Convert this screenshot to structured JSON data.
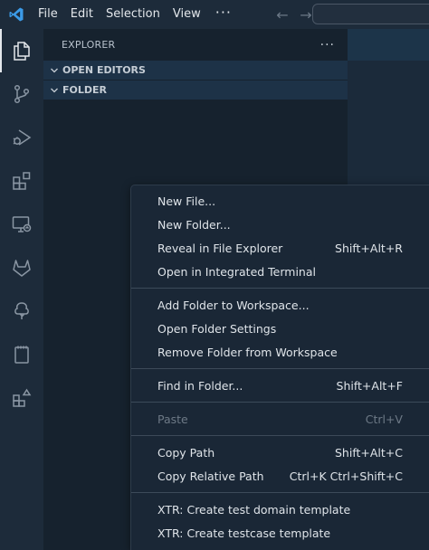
{
  "titlebar": {
    "menus": [
      "File",
      "Edit",
      "Selection",
      "View"
    ],
    "more": "···",
    "back_arrow": "←",
    "forward_arrow": "→"
  },
  "activitybar": {
    "icons": [
      "files-icon",
      "source-control-icon",
      "run-debug-icon",
      "extensions-icon",
      "remote-explorer-icon",
      "gitlab-icon",
      "tree-icon",
      "notebook-icon",
      "add-extension-icon"
    ]
  },
  "sidebar": {
    "title": "EXPLORER",
    "more": "···",
    "sections": [
      {
        "label": "OPEN EDITORS"
      },
      {
        "label": "FOLDER"
      }
    ]
  },
  "context_menu": {
    "groups": [
      [
        {
          "label": "New File...",
          "shortcut": ""
        },
        {
          "label": "New Folder...",
          "shortcut": ""
        },
        {
          "label": "Reveal in File Explorer",
          "shortcut": "Shift+Alt+R"
        },
        {
          "label": "Open in Integrated Terminal",
          "shortcut": ""
        }
      ],
      [
        {
          "label": "Add Folder to Workspace...",
          "shortcut": ""
        },
        {
          "label": "Open Folder Settings",
          "shortcut": ""
        },
        {
          "label": "Remove Folder from Workspace",
          "shortcut": ""
        }
      ],
      [
        {
          "label": "Find in Folder...",
          "shortcut": "Shift+Alt+F"
        }
      ],
      [
        {
          "label": "Paste",
          "shortcut": "Ctrl+V",
          "disabled": true
        }
      ],
      [
        {
          "label": "Copy Path",
          "shortcut": "Shift+Alt+C"
        },
        {
          "label": "Copy Relative Path",
          "shortcut": "Ctrl+K Ctrl+Shift+C"
        }
      ],
      [
        {
          "label": "XTR: Create test domain template",
          "shortcut": ""
        },
        {
          "label": "XTR: Create testcase template",
          "shortcut": ""
        }
      ]
    ]
  },
  "colors": {
    "accent": "#3b9be8",
    "menu_bg": "#1a2736",
    "sidebar_bg": "#16222e",
    "section_header_bg": "#1d3247"
  }
}
